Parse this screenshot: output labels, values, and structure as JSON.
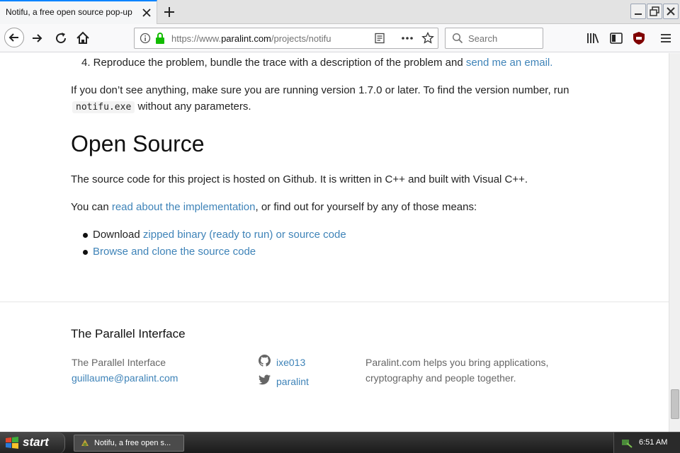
{
  "browser": {
    "tab_title": "Notifu, a free open source pop-up",
    "url_prefix": "https://www.",
    "url_domain": "paralint.com",
    "url_path": "/projects/notifu",
    "search_placeholder": "Search",
    "accent_color": "#0a84ff"
  },
  "content": {
    "step4_text": "4. Reproduce the problem, bundle the trace with a description of the problem and",
    "step4_link": "send me an email.",
    "version_text1": "If you don’t see anything, make sure you are running version 1.7.0 or later. To find the version number, run",
    "version_code": "notifu.exe",
    "version_text2": "without any parameters.",
    "heading": "Open Source",
    "source_text": "The source code for this project is hosted on Github. It is written in C++ and built with Visual C++.",
    "read_prefix": "You can",
    "read_link": "read about the implementation",
    "read_suffix": ", or find out for yourself by any of those means:",
    "bullet1_prefix": "Download",
    "bullet1_link": "zipped binary (ready to run) or source code",
    "bullet2_link": "Browse and clone the source code",
    "link_color": "#3e83b8"
  },
  "footer": {
    "title": "The Parallel Interface",
    "org": "The Parallel Interface",
    "email": "guillaume@paralint.com",
    "github": "ixe013",
    "twitter": "paralint",
    "tagline1": "Paralint.com helps you bring applications,",
    "tagline2": "cryptography and people together."
  },
  "taskbar": {
    "start_label": "start",
    "task_label": "Notifu, a free open s...",
    "clock": "6:51 AM"
  }
}
